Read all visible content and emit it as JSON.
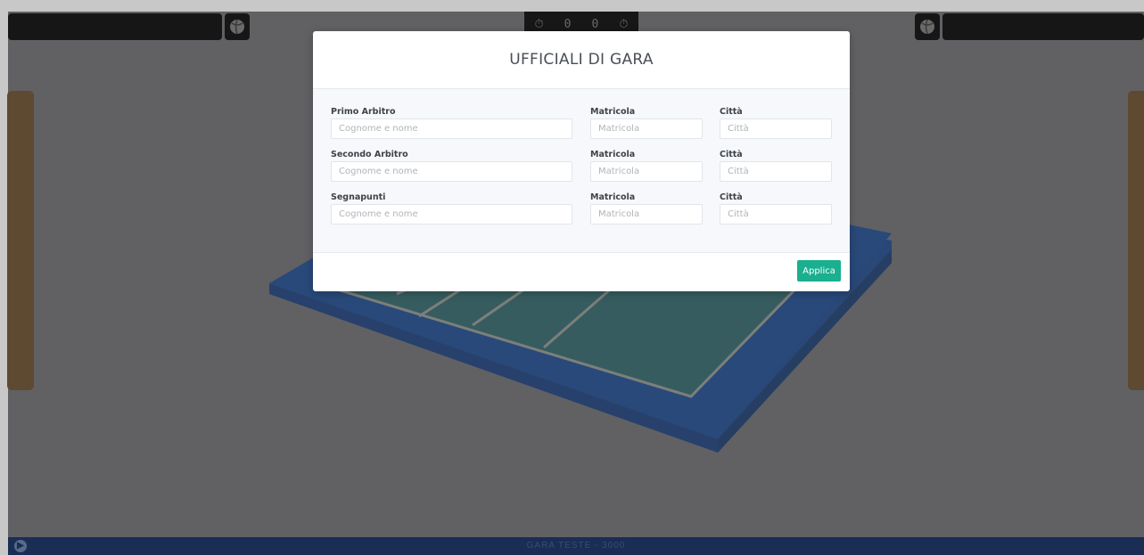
{
  "scoreboard": {
    "timer_icon": "stopwatch-icon",
    "timer_left_digit": "0",
    "timer_right_digit": "0",
    "ball_icon": "volleyball-icon"
  },
  "modal": {
    "title": "UFFICIALI DI GARA",
    "rows": [
      {
        "role_label": "Primo Arbitro",
        "name_placeholder": "Cognome e nome",
        "matricola_label": "Matricola",
        "matricola_placeholder": "Matricola",
        "city_label": "Città",
        "city_placeholder": "Città"
      },
      {
        "role_label": "Secondo Arbitro",
        "name_placeholder": "Cognome e nome",
        "matricola_label": "Matricola",
        "matricola_placeholder": "Matricola",
        "city_label": "Città",
        "city_placeholder": "Città"
      },
      {
        "role_label": "Segnapunti",
        "name_placeholder": "Cognome e nome",
        "matricola_label": "Matricola",
        "matricola_placeholder": "Matricola",
        "city_label": "Città",
        "city_placeholder": "Città"
      }
    ],
    "apply_label": "Applica"
  },
  "bottom_bar": {
    "match_title": "GARA TESTE - 3000",
    "info_icon": "play-circle-icon"
  },
  "colors": {
    "apply_button": "#1aaf8e",
    "court_surface": "#1f5a5e",
    "court_border": "#0b3a82",
    "bottom_bar": "#1a2d55"
  }
}
